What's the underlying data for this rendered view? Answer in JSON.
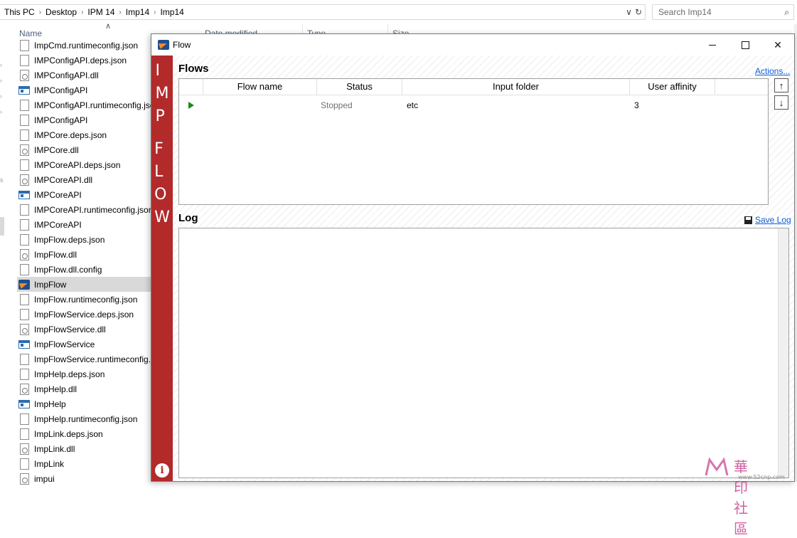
{
  "explorer": {
    "breadcrumb": [
      "This PC",
      "Desktop",
      "IPM 14",
      "Imp14",
      "Imp14"
    ],
    "search_placeholder": "Search Imp14",
    "columns": {
      "name": "Name",
      "date": "Date modified",
      "type": "Type",
      "size": "Size"
    },
    "files": [
      {
        "name": "ImpCmd.runtimeconfig.json",
        "icon": "json-file-icon"
      },
      {
        "name": "IMPConfigAPI.deps.json",
        "icon": "json-file-icon"
      },
      {
        "name": "IMPConfigAPI.dll",
        "icon": "dll-file-icon"
      },
      {
        "name": "IMPConfigAPI",
        "icon": "exe-file-icon"
      },
      {
        "name": "IMPConfigAPI.runtimeconfig.json",
        "icon": "json-file-icon"
      },
      {
        "name": "IMPConfigAPI",
        "icon": "json-file-icon"
      },
      {
        "name": "IMPCore.deps.json",
        "icon": "json-file-icon"
      },
      {
        "name": "IMPCore.dll",
        "icon": "dll-file-icon"
      },
      {
        "name": "IMPCoreAPI.deps.json",
        "icon": "json-file-icon"
      },
      {
        "name": "IMPCoreAPI.dll",
        "icon": "dll-file-icon"
      },
      {
        "name": "IMPCoreAPI",
        "icon": "exe-file-icon"
      },
      {
        "name": "IMPCoreAPI.runtimeconfig.json",
        "icon": "json-file-icon"
      },
      {
        "name": "IMPCoreAPI",
        "icon": "json-file-icon"
      },
      {
        "name": "ImpFlow.deps.json",
        "icon": "json-file-icon"
      },
      {
        "name": "ImpFlow.dll",
        "icon": "dll-file-icon"
      },
      {
        "name": "ImpFlow.dll.config",
        "icon": "json-file-icon"
      },
      {
        "name": "ImpFlow",
        "icon": "app-icon",
        "selected": true
      },
      {
        "name": "ImpFlow.runtimeconfig.json",
        "icon": "json-file-icon"
      },
      {
        "name": "ImpFlowService.deps.json",
        "icon": "json-file-icon"
      },
      {
        "name": "ImpFlowService.dll",
        "icon": "dll-file-icon"
      },
      {
        "name": "ImpFlowService",
        "icon": "exe-file-icon"
      },
      {
        "name": "ImpFlowService.runtimeconfig.json",
        "icon": "json-file-icon"
      },
      {
        "name": "ImpHelp.deps.json",
        "icon": "json-file-icon"
      },
      {
        "name": "ImpHelp.dll",
        "icon": "dll-file-icon"
      },
      {
        "name": "ImpHelp",
        "icon": "exe-file-icon"
      },
      {
        "name": "ImpHelp.runtimeconfig.json",
        "icon": "json-file-icon"
      },
      {
        "name": "ImpLink.deps.json",
        "icon": "json-file-icon"
      },
      {
        "name": "ImpLink.dll",
        "icon": "dll-file-icon"
      },
      {
        "name": "ImpLink",
        "icon": "json-file-icon"
      },
      {
        "name": "impui",
        "icon": "dll-file-icon"
      }
    ]
  },
  "flow_window": {
    "title": "Flow",
    "sidebar_letters_1": [
      "I",
      "M",
      "P"
    ],
    "sidebar_letters_2": [
      "F",
      "L",
      "O",
      "W"
    ],
    "flows_title": "Flows",
    "actions_link": "Actions...",
    "table_headers": [
      "Flow name",
      "Status",
      "Input folder",
      "User affinity"
    ],
    "rows": [
      {
        "flow_name": "",
        "status": "Stopped",
        "input_folder": "etc",
        "user_affinity": "3"
      }
    ],
    "log_title": "Log",
    "save_log_link": "Save Log",
    "info_label": "i"
  },
  "watermark": {
    "text": "華印社區",
    "small": "www.52cnp.com"
  },
  "colors": {
    "sidebar_red": "#b22a2a",
    "link_blue": "#0b5fd6",
    "play_green": "#1a8a1a"
  }
}
